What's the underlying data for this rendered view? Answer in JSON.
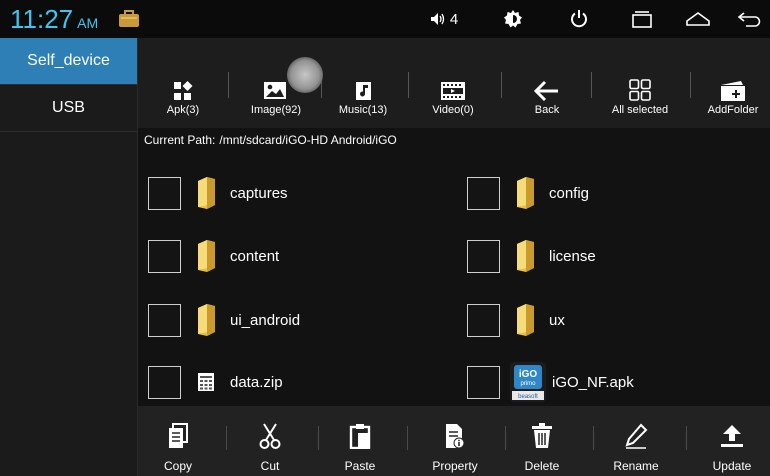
{
  "status": {
    "time": "11:27",
    "ampm": "AM",
    "volume_level": "4"
  },
  "sidebar": {
    "items": [
      {
        "label": "Self_device",
        "active": true
      },
      {
        "label": "USB",
        "active": false
      }
    ]
  },
  "toolbar": {
    "items": [
      {
        "label": "Apk(3)",
        "icon": "apk-icon"
      },
      {
        "label": "Image(92)",
        "icon": "image-icon"
      },
      {
        "label": "Music(13)",
        "icon": "music-icon"
      },
      {
        "label": "Video(0)",
        "icon": "video-icon"
      },
      {
        "label": "Back",
        "icon": "back-arrow-icon"
      },
      {
        "label": "All selected",
        "icon": "select-all-icon"
      },
      {
        "label": "AddFolder",
        "icon": "add-folder-icon"
      }
    ]
  },
  "path": {
    "label": "Current Path:",
    "value": "/mnt/sdcard/iGO-HD Android/iGO"
  },
  "files": [
    {
      "name": "captures",
      "type": "folder"
    },
    {
      "name": "config",
      "type": "folder"
    },
    {
      "name": "content",
      "type": "folder"
    },
    {
      "name": "license",
      "type": "folder"
    },
    {
      "name": "ui_android",
      "type": "folder"
    },
    {
      "name": "ux",
      "type": "folder"
    },
    {
      "name": "data.zip",
      "type": "zip"
    },
    {
      "name": "iGO_NF.apk",
      "type": "apk",
      "logo_text": "iGO",
      "logo_subtext": "primo",
      "logo_brand": "beasoft"
    }
  ],
  "bottombar": {
    "items": [
      {
        "label": "Copy",
        "icon": "copy-icon"
      },
      {
        "label": "Cut",
        "icon": "scissors-icon"
      },
      {
        "label": "Paste",
        "icon": "paste-icon"
      },
      {
        "label": "Property",
        "icon": "property-icon"
      },
      {
        "label": "Delete",
        "icon": "trash-icon"
      },
      {
        "label": "Rename",
        "icon": "pencil-icon"
      },
      {
        "label": "Update",
        "icon": "upload-icon"
      }
    ]
  },
  "colors": {
    "accent": "#3ec6f0",
    "sidebar_active": "#2e7fb6",
    "folder": "#f2d25a"
  }
}
